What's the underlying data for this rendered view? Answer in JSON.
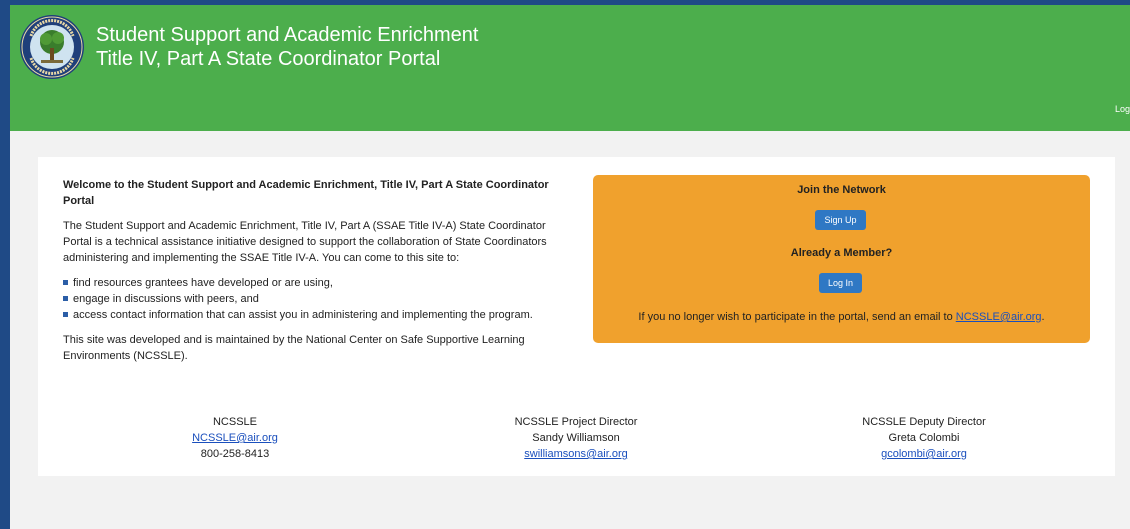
{
  "header": {
    "title_line1": "Student Support and Academic Enrichment",
    "title_line2": "Title IV, Part A State Coordinator Portal",
    "login_link": "Log",
    "seal_text": "DEPARTMENT OF EDUCATION · UNITED STATES OF AMERICA",
    "colors": {
      "green": "#4cae4c",
      "navy": "#1f4a86"
    }
  },
  "main": {
    "welcome_heading": "Welcome to the Student Support and Academic Enrichment, Title IV, Part A State Coordinator Portal",
    "intro": "The Student Support and Academic Enrichment, Title IV, Part A (SSAE Title IV-A) State Coordinator Portal is a technical assistance initiative designed to support the collaboration of State Coordinators administering and implementing the SSAE Title IV-A. You can come to this site to:",
    "bullets": [
      "find resources grantees have developed or are using,",
      "engage in discussions with peers, and",
      "access contact information that can assist you in administering and implementing the program."
    ],
    "maintained_by": "This site was developed and is maintained by the National Center on Safe Supportive Learning Environments (NCSSLE)."
  },
  "panel": {
    "join_heading": "Join the Network",
    "signup_label": "Sign Up",
    "member_heading": "Already a Member?",
    "login_label": "Log In",
    "optout_text": "If you no longer wish to participate in the portal, send an email to",
    "optout_email": "NCSSLE@air.org",
    "optout_period": ".",
    "color": "#f0a12d"
  },
  "contacts": [
    {
      "title": "NCSSLE",
      "line2": "NCSSLE@air.org",
      "line3": "800-258-8413"
    },
    {
      "title": "NCSSLE Project Director",
      "line2": "Sandy Williamson",
      "line3": "swilliamsons@air.org"
    },
    {
      "title": "NCSSLE Deputy Director",
      "line2": "Greta Colombi",
      "line3": "gcolombi@air.org"
    }
  ]
}
